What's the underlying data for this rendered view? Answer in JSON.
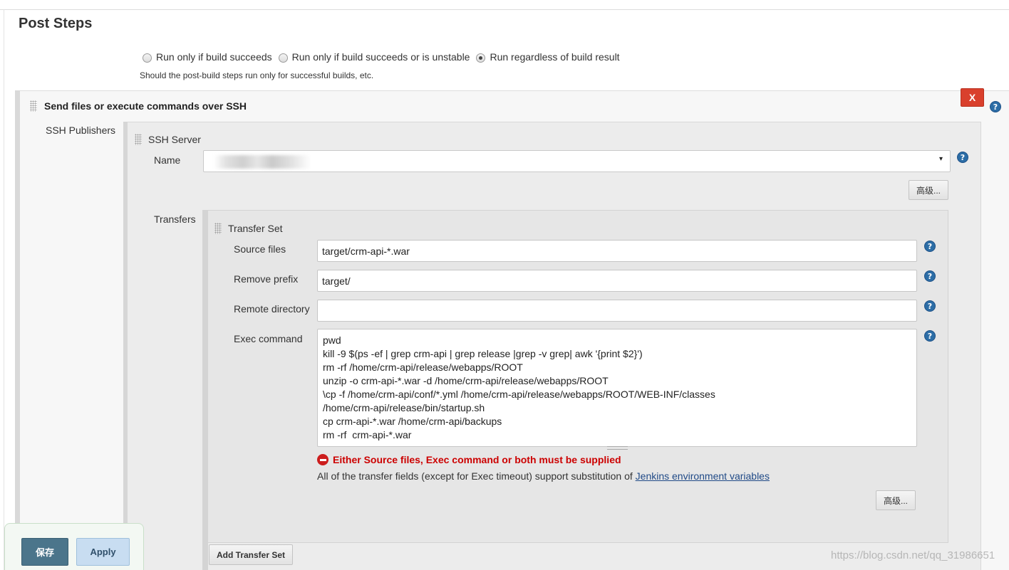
{
  "section": {
    "title": "Post Steps",
    "run_options": [
      {
        "label": "Run only if build succeeds",
        "checked": false
      },
      {
        "label": "Run only if build succeeds or is unstable",
        "checked": false
      },
      {
        "label": "Run regardless of build result",
        "checked": true
      }
    ],
    "run_hint": "Should the post-build steps run only for successful builds, etc."
  },
  "step": {
    "title": "Send files or execute commands over SSH",
    "delete_label": "X",
    "publishers_label": "SSH Publishers"
  },
  "ssh_server": {
    "title": "SSH Server",
    "name_label": "Name",
    "name_arrow": "▾",
    "advanced_label": "高级..."
  },
  "transfers": {
    "label": "Transfers",
    "set_title": "Transfer Set",
    "source_files_label": "Source files",
    "source_files_value": "target/crm-api-*.war",
    "remove_prefix_label": "Remove prefix",
    "remove_prefix_value": "target/",
    "remote_directory_label": "Remote directory",
    "remote_directory_value": "",
    "exec_command_label": "Exec command",
    "exec_command_lines": [
      "pwd",
      "kill -9 $(ps -ef | grep crm-api | grep release |grep -v grep| awk '{print $2}')",
      "rm -rf /home/crm-api/release/webapps/ROOT",
      "unzip -o crm-api-*.war -d /home/crm-api/release/webapps/ROOT",
      "\\cp -f /home/crm-api/conf/*.yml /home/crm-api/release/webapps/ROOT/WEB-INF/classes",
      "/home/crm-api/release/bin/startup.sh",
      "cp crm-api-*.war /home/crm-api/backups",
      "rm -rf  crm-api-*.war"
    ],
    "error_text": "Either Source files, Exec command or both must be supplied",
    "info_text": "All of the transfer fields (except for Exec timeout) support substitution of ",
    "info_link": "Jenkins environment variables",
    "advanced_label": "高级...",
    "add_button_label": "Add Transfer Set"
  },
  "help_icon_glyph": "?",
  "footer": {
    "save_label": "保存",
    "apply_label": "Apply"
  },
  "watermark": "https://blog.csdn.net/qq_31986651"
}
